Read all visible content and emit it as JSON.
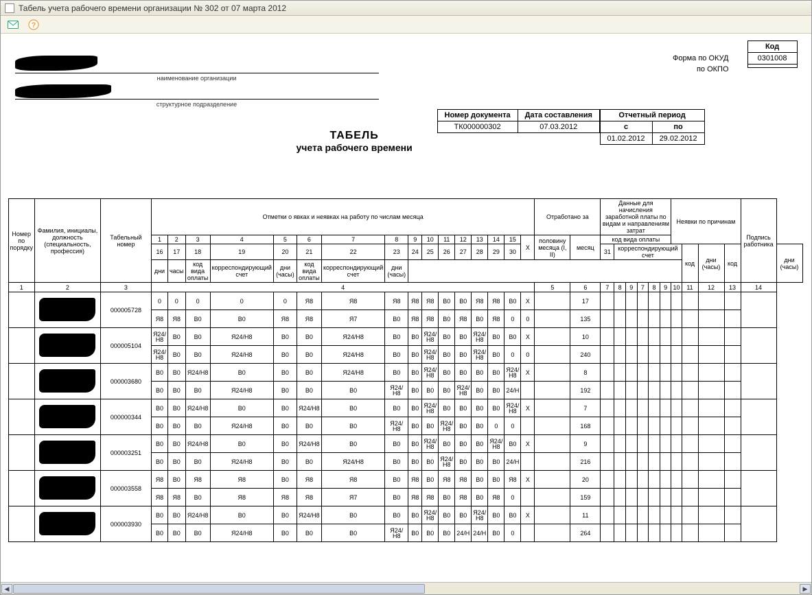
{
  "window": {
    "title": "Табель учета рабочего времени организации № 302 от 07 марта 2012"
  },
  "toolbar": {
    "email_tip": "Отправить",
    "help_tip": "Справка"
  },
  "header": {
    "kod_label": "Код",
    "okud_label": "Форма по ОКУД",
    "okud_value": "0301008",
    "okpo_label": "по ОКПО",
    "okpo_value": "",
    "org_caption": "наименование организации",
    "dep_caption": "структурное подразделение",
    "doc_no_label": "Номер документа",
    "doc_no_value": "ТК000000302",
    "doc_date_label": "Дата составления",
    "doc_date_value": "07.03.2012",
    "period_label": "Отчетный период",
    "period_from_label": "с",
    "period_to_label": "по",
    "period_from": "01.02.2012",
    "period_to": "29.02.2012",
    "title_line1": "ТАБЕЛЬ",
    "title_line2": "учета  рабочего времени"
  },
  "columns": {
    "no": "Номер по порядку",
    "name": "Фамилия, инициалы, должность (специальность, профессия)",
    "tab": "Табельный номер",
    "marks": "Отметки о явках и неявках на работу по числам месяца",
    "worked": "Отработано за",
    "half": "половину месяца (I, II)",
    "month": "месяц",
    "days": "дни",
    "hours": "часы",
    "pay": "Данные для начисления заработной платы по видам и направлениям затрат",
    "pay_type": "код вида оплаты",
    "corr": "корреспондирующий счет",
    "pay_kod": "код вида оплаты",
    "pay_corr": "корреспондирующий счет",
    "pay_daysh": "дни (часы)",
    "absence": "Неявки по причинам",
    "abs_kod": "код",
    "abs_daysh": "дни (часы)",
    "sign": "Подпись работника",
    "x": "X",
    "day_top": [
      "1",
      "2",
      "3",
      "4",
      "5",
      "6",
      "7",
      "8",
      "9",
      "10",
      "11",
      "12",
      "13",
      "14",
      "15"
    ],
    "day_bot": [
      "16",
      "17",
      "18",
      "19",
      "20",
      "21",
      "22",
      "23",
      "24",
      "25",
      "26",
      "27",
      "28",
      "29",
      "30",
      "31"
    ],
    "num_row": [
      "1",
      "2",
      "3",
      "4",
      "5",
      "6",
      "7",
      "8",
      "9",
      "7",
      "8",
      "9",
      "10",
      "11",
      "12",
      "13",
      "14"
    ]
  },
  "employees": [
    {
      "tab_num": "000005728",
      "row1": [
        "0",
        "0",
        "0",
        "0",
        "0",
        "Я8",
        "Я8",
        "Я8",
        "Я8",
        "Я8",
        "В0",
        "В0",
        "Я8",
        "Я8",
        "В0",
        "X"
      ],
      "row2": [
        "Я8",
        "Я8",
        "В0",
        "В0",
        "Я8",
        "Я8",
        "Я7",
        "В0",
        "Я8",
        "Я8",
        "В0",
        "Я8",
        "В0",
        "Я8",
        "0",
        "0"
      ],
      "days": "17",
      "hours": "135"
    },
    {
      "tab_num": "000005104",
      "row1": [
        "Я24/Н8",
        "В0",
        "В0",
        "Я24/Н8",
        "В0",
        "В0",
        "Я24/Н8",
        "В0",
        "В0",
        "Я24/Н8",
        "В0",
        "В0",
        "Я24/Н8",
        "В0",
        "В0",
        "X"
      ],
      "row2": [
        "Я24/Н8",
        "В0",
        "В0",
        "Я24/Н8",
        "В0",
        "В0",
        "Я24/Н8",
        "В0",
        "В0",
        "Я24/Н8",
        "В0",
        "В0",
        "Я24/Н8",
        "В0",
        "0",
        "0"
      ],
      "days": "10",
      "hours": "240"
    },
    {
      "tab_num": "000003680",
      "row1": [
        "В0",
        "В0",
        "Я24/Н8",
        "В0",
        "В0",
        "В0",
        "Я24/Н8",
        "В0",
        "В0",
        "Я24/Н8",
        "В0",
        "В0",
        "В0",
        "В0",
        "Я24/Н8",
        "X"
      ],
      "row2": [
        "В0",
        "В0",
        "В0",
        "Я24/Н8",
        "В0",
        "В0",
        "В0",
        "Я24/Н8",
        "В0",
        "В0",
        "В0",
        "Я24/Н8",
        "В0",
        "В0",
        "24/Н",
        ""
      ],
      "days": "8",
      "hours": "192"
    },
    {
      "tab_num": "000000344",
      "row1": [
        "В0",
        "В0",
        "Я24/Н8",
        "В0",
        "В0",
        "Я24/Н8",
        "В0",
        "В0",
        "В0",
        "Я24/Н8",
        "В0",
        "В0",
        "В0",
        "В0",
        "Я24/Н8",
        "X"
      ],
      "row2": [
        "В0",
        "В0",
        "В0",
        "Я24/Н8",
        "В0",
        "В0",
        "В0",
        "Я24/Н8",
        "В0",
        "В0",
        "Я24/Н8",
        "В0",
        "В0",
        "0",
        "0",
        ""
      ],
      "days": "7",
      "hours": "168"
    },
    {
      "tab_num": "000003251",
      "row1": [
        "В0",
        "В0",
        "Я24/Н8",
        "В0",
        "В0",
        "Я24/Н8",
        "В0",
        "В0",
        "В0",
        "Я24/Н8",
        "В0",
        "В0",
        "В0",
        "Я24/Н8",
        "В0",
        "X"
      ],
      "row2": [
        "В0",
        "В0",
        "В0",
        "Я24/Н8",
        "В0",
        "В0",
        "Я24/Н8",
        "В0",
        "В0",
        "В0",
        "Я24/Н8",
        "В0",
        "В0",
        "В0",
        "24/Н",
        ""
      ],
      "days": "9",
      "hours": "216"
    },
    {
      "tab_num": "000003558",
      "row1": [
        "Я8",
        "В0",
        "Я8",
        "Я8",
        "В0",
        "Я8",
        "Я8",
        "В0",
        "Я8",
        "В0",
        "Я8",
        "Я8",
        "В0",
        "В0",
        "Я8",
        "X"
      ],
      "row2": [
        "Я8",
        "Я8",
        "В0",
        "Я8",
        "Я8",
        "Я8",
        "Я7",
        "В0",
        "Я8",
        "Я8",
        "В0",
        "Я8",
        "В0",
        "Я8",
        "0",
        ""
      ],
      "days": "20",
      "hours": "159"
    },
    {
      "tab_num": "000003930",
      "row1": [
        "В0",
        "В0",
        "Я24/Н8",
        "В0",
        "В0",
        "Я24/Н8",
        "В0",
        "В0",
        "В0",
        "Я24/Н8",
        "В0",
        "В0",
        "Я24/Н8",
        "В0",
        "В0",
        "X"
      ],
      "row2": [
        "В0",
        "В0",
        "В0",
        "Я24/Н8",
        "В0",
        "В0",
        "В0",
        "Я24/Н8",
        "В0",
        "В0",
        "В0",
        "24/Н",
        "24/Н",
        "В0",
        "0",
        ""
      ],
      "days": "11",
      "hours": "264"
    }
  ]
}
